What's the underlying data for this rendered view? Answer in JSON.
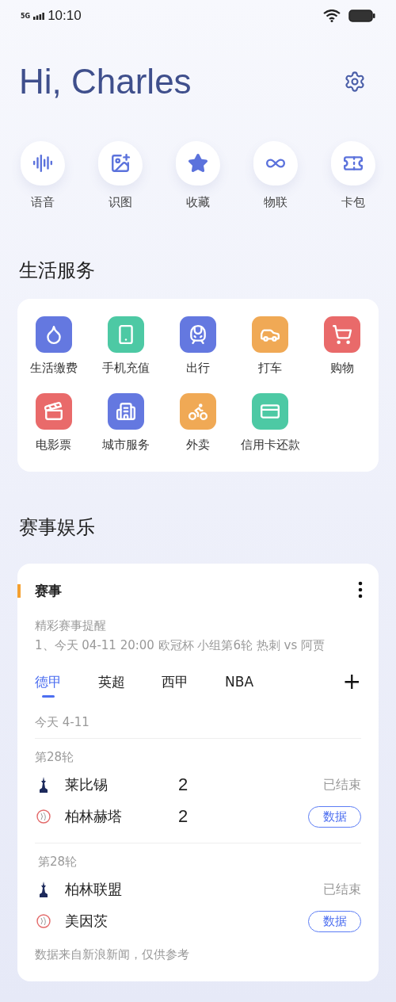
{
  "status_bar": {
    "network": "5G",
    "time": "10:10"
  },
  "greeting": "Hi, Charles",
  "quick_actions": [
    {
      "label": "语音",
      "kind": "voice"
    },
    {
      "label": "识图",
      "kind": "image"
    },
    {
      "label": "收藏",
      "kind": "star"
    },
    {
      "label": "物联",
      "kind": "link"
    },
    {
      "label": "卡包",
      "kind": "ticket"
    }
  ],
  "life_services": {
    "title": "生活服务",
    "items": [
      {
        "label": "生活缴费",
        "kind": "bill",
        "color": "#6478e0"
      },
      {
        "label": "手机充值",
        "kind": "phone",
        "color": "#4dc9a4"
      },
      {
        "label": "出行",
        "kind": "travel",
        "color": "#6478e0"
      },
      {
        "label": "打车",
        "kind": "car",
        "color": "#f0a955"
      },
      {
        "label": "购物",
        "kind": "cart",
        "color": "#e96a6a"
      },
      {
        "label": "电影票",
        "kind": "movie",
        "color": "#e96a6a"
      },
      {
        "label": "城市服务",
        "kind": "city",
        "color": "#6478e0"
      },
      {
        "label": "外卖",
        "kind": "scooter",
        "color": "#f0a955"
      },
      {
        "label": "信用卡还款",
        "kind": "card",
        "color": "#4dc9a4"
      }
    ]
  },
  "sports": {
    "title": "赛事娱乐",
    "card": {
      "title": "赛事",
      "reminder_title": "精彩赛事提醒",
      "reminder": "1、今天 04-11 20:00 欧冠杯 小组第6轮 热刺 vs 阿贾",
      "tabs": [
        {
          "label": "德甲",
          "selected": true
        },
        {
          "label": "英超",
          "selected": false
        },
        {
          "label": "西甲",
          "selected": false
        },
        {
          "label": "NBA",
          "selected": false
        }
      ],
      "add": "+",
      "date": "今天 4-11",
      "matches": [
        {
          "round": "第28轮",
          "status": "已结束",
          "action": "数据",
          "teams": [
            {
              "name": "莱比锡",
              "score": "2",
              "kind": "tall"
            },
            {
              "name": "柏林赫塔",
              "score": "2",
              "kind": "round"
            }
          ]
        },
        {
          "round": "第28轮",
          "status": "已结束",
          "action": "数据",
          "teams": [
            {
              "name": "柏林联盟",
              "kind": "tall"
            },
            {
              "name": "美因茨",
              "kind": "round"
            }
          ]
        }
      ],
      "source": "数据来自新浪新闻，仅供参考"
    }
  }
}
